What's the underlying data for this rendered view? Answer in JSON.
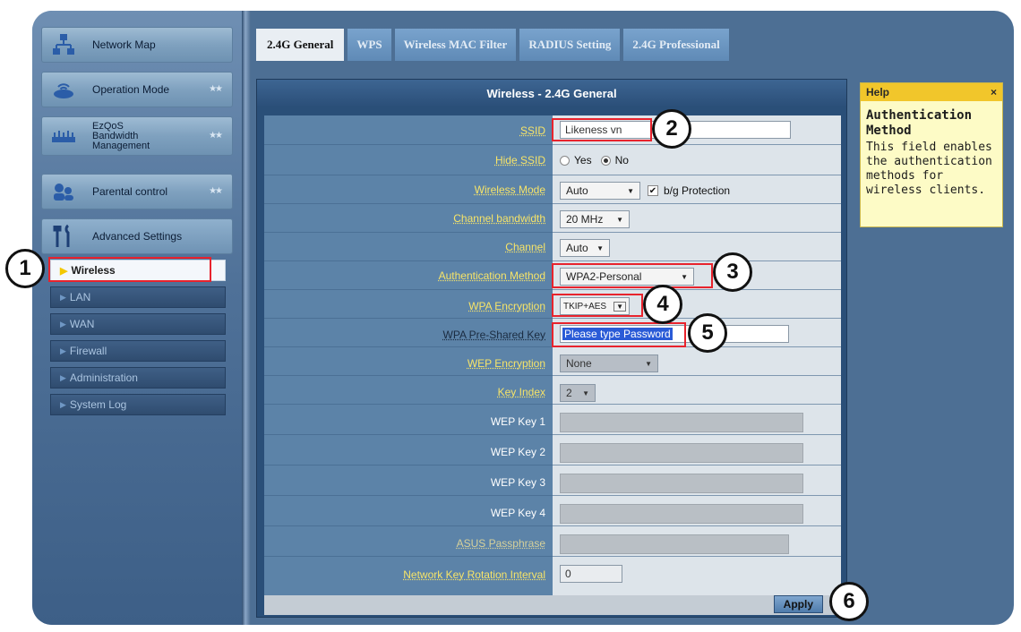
{
  "sidebar": {
    "items": [
      {
        "label": "Network Map",
        "icon": "network-map-icon"
      },
      {
        "label": "Operation Mode",
        "icon": "router-icon"
      },
      {
        "label": "EzQoS\nBandwidth\nManagement",
        "icon": "bandwidth-icon"
      },
      {
        "label": "Parental control",
        "icon": "parental-icon"
      },
      {
        "label": "Advanced Settings",
        "icon": "tools-icon"
      }
    ],
    "sub_items": [
      "Wireless",
      "LAN",
      "WAN",
      "Firewall",
      "Administration",
      "System Log"
    ]
  },
  "tabs": [
    "2.4G General",
    "WPS",
    "Wireless MAC Filter",
    "RADIUS Setting",
    "2.4G Professional"
  ],
  "panel": {
    "title": "Wireless - 2.4G General",
    "fields": {
      "ssid": {
        "label": "SSID",
        "value": "Likeness vn"
      },
      "hide_ssid": {
        "label": "Hide SSID",
        "yes": "Yes",
        "no": "No"
      },
      "wireless_mode": {
        "label": "Wireless Mode",
        "value": "Auto",
        "bg_protection": "b/g Protection"
      },
      "channel_bandwidth": {
        "label": "Channel bandwidth",
        "value": "20 MHz"
      },
      "channel": {
        "label": "Channel",
        "value": "Auto"
      },
      "auth_method": {
        "label": "Authentication Method",
        "value": "WPA2-Personal"
      },
      "wpa_encryption": {
        "label": "WPA Encryption",
        "value": "TKIP+AES"
      },
      "wpa_psk": {
        "label": "WPA Pre-Shared Key",
        "value": "Please type Password"
      },
      "wep_encryption": {
        "label": "WEP Encryption",
        "value": "None"
      },
      "key_index": {
        "label": "Key Index",
        "value": "2"
      },
      "wep_key1": {
        "label": "WEP Key 1"
      },
      "wep_key2": {
        "label": "WEP Key 2"
      },
      "wep_key3": {
        "label": "WEP Key 3"
      },
      "wep_key4": {
        "label": "WEP Key 4"
      },
      "asus_passphrase": {
        "label": "ASUS Passphrase"
      },
      "rotation_interval": {
        "label": "Network Key Rotation Interval",
        "value": "0"
      }
    },
    "apply_label": "Apply"
  },
  "help": {
    "header": "Help",
    "close": "×",
    "title": "Authentication Method",
    "body": "This field enables the authentication methods for wireless clients."
  },
  "annotations": [
    "1",
    "2",
    "3",
    "4",
    "5",
    "6"
  ],
  "colors": {
    "highlight": "#e8232d",
    "label_yellow": "#f7e468",
    "help_header": "#f1c62b"
  }
}
